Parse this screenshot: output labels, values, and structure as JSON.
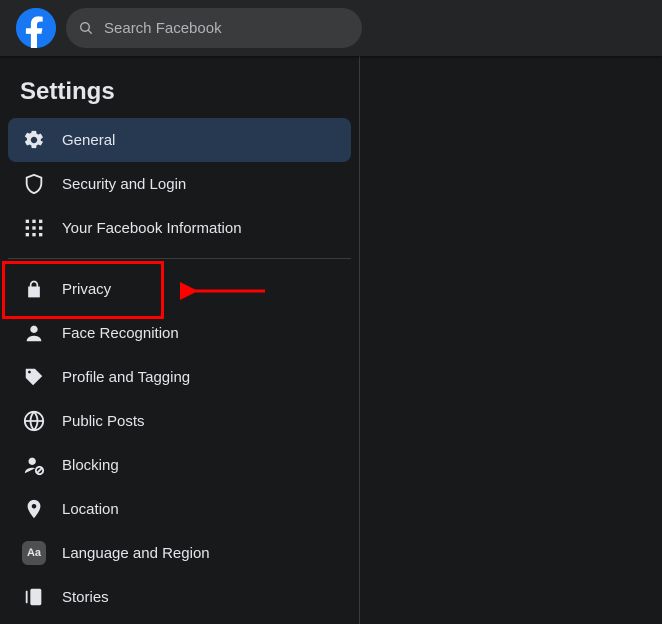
{
  "header": {
    "search_placeholder": "Search Facebook"
  },
  "sidebar": {
    "title": "Settings",
    "items": [
      {
        "label": "General",
        "icon": "gear-icon",
        "active": true
      },
      {
        "label": "Security and Login",
        "icon": "shield-icon",
        "active": false
      },
      {
        "label": "Your Facebook Information",
        "icon": "grid-icon",
        "active": false
      }
    ],
    "items2": [
      {
        "label": "Privacy",
        "icon": "lock-icon",
        "highlighted": true
      },
      {
        "label": "Face Recognition",
        "icon": "face-icon"
      },
      {
        "label": "Profile and Tagging",
        "icon": "tag-icon"
      },
      {
        "label": "Public Posts",
        "icon": "globe-icon"
      },
      {
        "label": "Blocking",
        "icon": "block-icon"
      },
      {
        "label": "Location",
        "icon": "location-icon"
      },
      {
        "label": "Language and Region",
        "icon": "language-icon",
        "badge_text": "Aa"
      },
      {
        "label": "Stories",
        "icon": "stories-icon"
      }
    ]
  }
}
